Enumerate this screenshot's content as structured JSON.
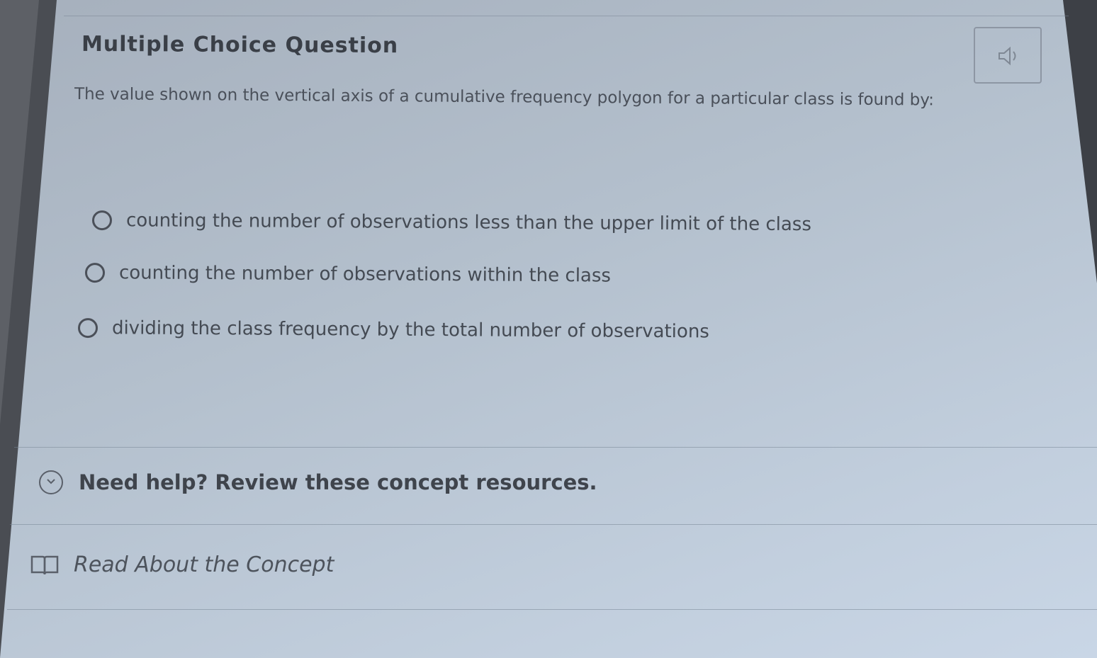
{
  "question": {
    "title": "Multiple Choice Question",
    "prompt": "The value shown on the vertical axis of a cumulative frequency polygon for a particular class is found by:",
    "options": [
      {
        "label": "counting the number of observations less than the upper limit of the class",
        "selected": false
      },
      {
        "label": "counting the number of observations within the class",
        "selected": false
      },
      {
        "label": "dividing the class frequency by the total number of observations",
        "selected": false
      }
    ],
    "speaker_icon": "speaker-icon"
  },
  "help": {
    "label": "Need help? Review these concept resources.",
    "icon": "chevron-down-icon"
  },
  "resources": {
    "read_concept_label": "Read About the Concept",
    "icon": "book-icon"
  },
  "colors": {
    "background": "#bcc8d6",
    "text": "#444a53",
    "heading": "#3a3f47"
  }
}
